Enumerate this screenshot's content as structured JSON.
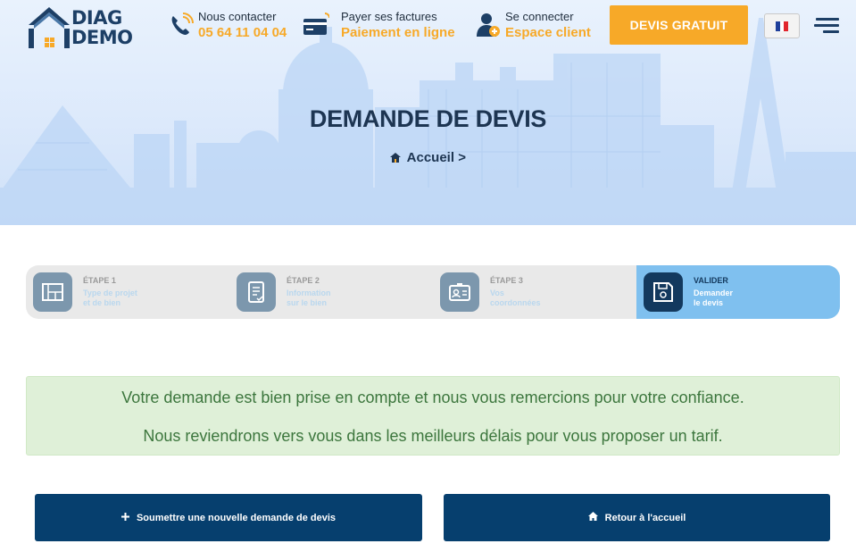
{
  "header": {
    "logo": {
      "line1": "DIAG",
      "line2": "DEMO"
    },
    "contact": {
      "label": "Nous contacter",
      "value": "05 64 11 04 04",
      "icon": "phone-icon"
    },
    "billing": {
      "label": "Payer ses factures",
      "value": "Paiement en ligne",
      "icon": "credit-card-icon"
    },
    "login": {
      "label": "Se connecter",
      "value": "Espace client",
      "icon": "user-icon"
    },
    "cta_label": "DEVIS GRATUIT",
    "language_flag": "french-flag-icon",
    "menu_icon": "hamburger-menu-icon"
  },
  "hero": {
    "title": "DEMANDE DE DEVIS",
    "breadcrumb_home": "Accueil",
    "breadcrumb_separator": ">"
  },
  "steps": [
    {
      "title": "ÉTAPE 1",
      "line1": "Type de projet",
      "line2": "et de bien",
      "icon": "blueprint-icon",
      "active": false
    },
    {
      "title": "ÉTAPE 2",
      "line1": "Information",
      "line2": "sur le bien",
      "icon": "checklist-icon",
      "active": false
    },
    {
      "title": "ÉTAPE 3",
      "line1": "Vos",
      "line2": "coordonnées",
      "icon": "id-card-icon",
      "active": false
    },
    {
      "title": "VALIDER",
      "line1": "Demander",
      "line2": "le devis",
      "icon": "save-icon",
      "active": true
    }
  ],
  "confirmation": {
    "line1": "Votre demande est bien prise en compte et nous vous remercions pour votre confiance.",
    "line2": "Nous reviendrons vers vous dans les meilleurs délais pour vous proposer un tarif."
  },
  "actions": {
    "new_request": {
      "label": "Soumettre une nouvelle demande de devis",
      "icon": "plus-icon"
    },
    "home": {
      "label": "Retour à l'accueil",
      "icon": "home-icon"
    }
  },
  "colors": {
    "brand_navy": "#1d3f66",
    "accent_orange": "#f7a928",
    "active_step": "#7fc0ef",
    "button_navy": "#063f6e",
    "success_bg": "#dff0d8",
    "success_text": "#3c763d"
  }
}
